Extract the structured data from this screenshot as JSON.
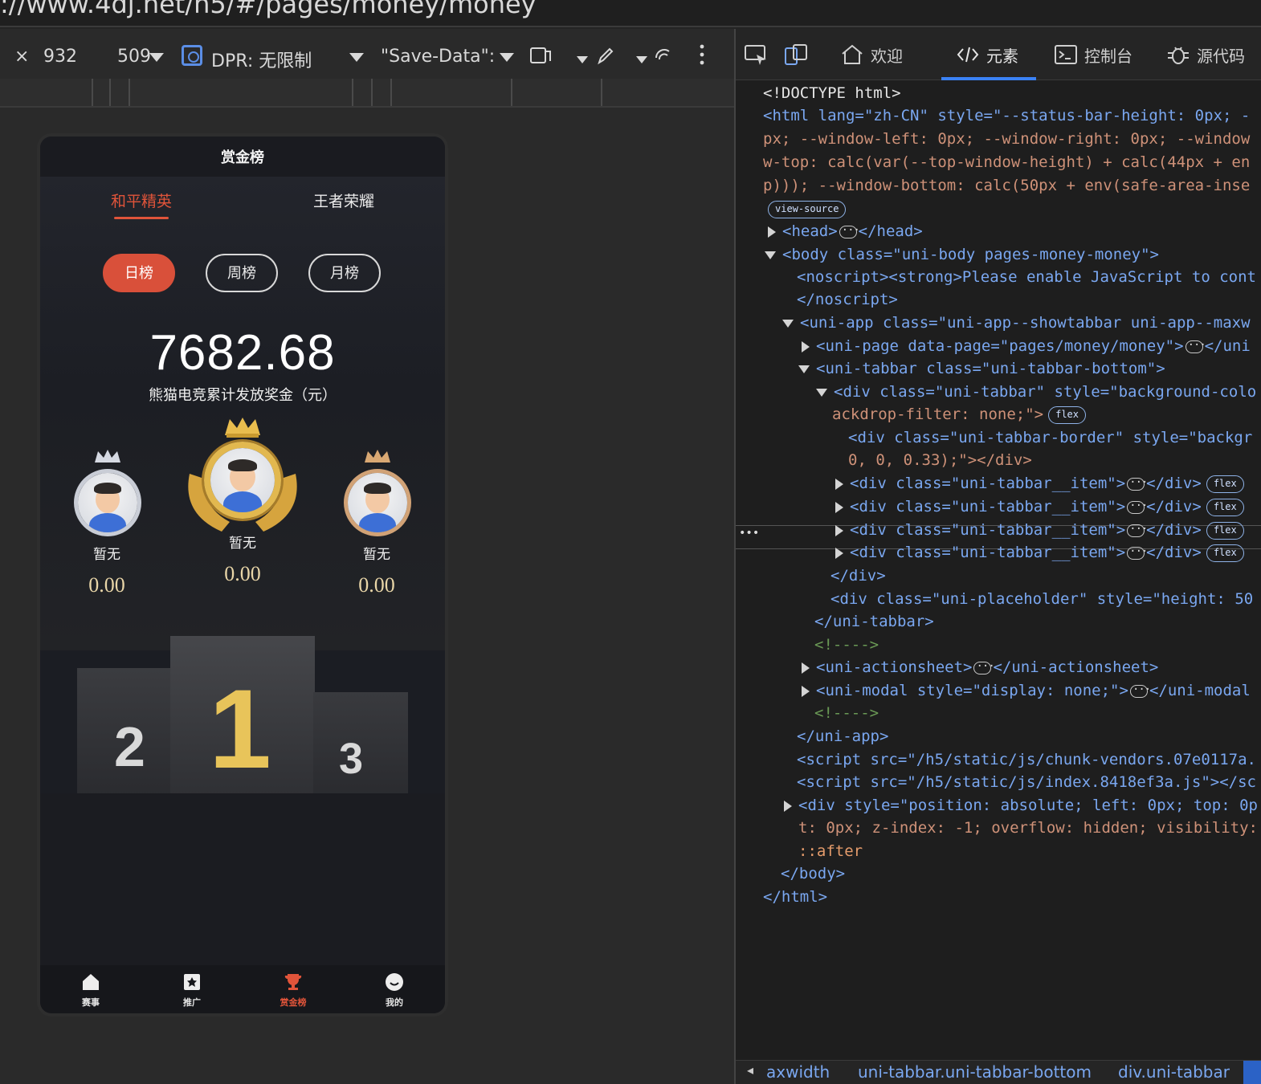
{
  "browser": {
    "url_fragment": "://www.4dj.net/h5/#/pages/money/money"
  },
  "emulator": {
    "close": "×",
    "width": "932",
    "height": "509",
    "dpr_label": "DPR: 无限制",
    "save_data_label": "\"Save-Data\":"
  },
  "phone": {
    "title": "赏金榜",
    "game_tabs": [
      {
        "label": "和平精英",
        "active": true
      },
      {
        "label": "王者荣耀",
        "active": false
      }
    ],
    "period_tabs": [
      {
        "label": "日榜",
        "active": true
      },
      {
        "label": "周榜",
        "active": false
      },
      {
        "label": "月榜",
        "active": false
      }
    ],
    "total_amount": "7682.68",
    "total_label": "熊猫电竞累计发放奖金（元）",
    "ranks": [
      {
        "rank": "1",
        "name": "暂无",
        "amount": "0.00"
      },
      {
        "rank": "2",
        "name": "暂无",
        "amount": "0.00"
      },
      {
        "rank": "3",
        "name": "暂无",
        "amount": "0.00"
      }
    ],
    "tabbar": [
      {
        "label": "赛事",
        "icon": "home-icon",
        "active": false
      },
      {
        "label": "推广",
        "icon": "promote-icon",
        "active": false
      },
      {
        "label": "赏金榜",
        "icon": "trophy-icon",
        "active": true
      },
      {
        "label": "我的",
        "icon": "profile-icon",
        "active": false
      }
    ],
    "colors": {
      "accent": "#e0543a",
      "gold": "#e2b84f"
    }
  },
  "devtools": {
    "tabs": [
      {
        "label": "欢迎",
        "icon": "home-icon"
      },
      {
        "label": "元素",
        "icon": "code-icon",
        "active": true
      },
      {
        "label": "控制台",
        "icon": "console-icon"
      },
      {
        "label": "源代码",
        "icon": "bug-icon"
      }
    ],
    "lines": {
      "l1": "<!DOCTYPE html>",
      "l2": "<html lang=\"zh-CN\" style=\"--status-bar-height: 0px; -",
      "l3": "px; --window-left: 0px; --window-right: 0px; --window",
      "l4": "w-top: calc(var(--top-window-height) + calc(44px + en",
      "l5": "p))); --window-bottom: calc(50px + env(safe-area-inse",
      "view_source": "view-source",
      "l6a": "<head>",
      "l6b": "</head>",
      "l7": "<body class=\"uni-body pages-money-money\">",
      "l8": "<noscript><strong>Please enable JavaScript to cont",
      "l9": "</noscript>",
      "l10": "<uni-app class=\"uni-app--showtabbar uni-app--maxw",
      "l11a": "<uni-page data-page=\"pages/money/money\">",
      "l11b": "</uni",
      "l12": "<uni-tabbar class=\"uni-tabbar-bottom\">",
      "l13": "<div class=\"uni-tabbar\" style=\"background-colo",
      "l14": "ackdrop-filter: none;\">",
      "flex": "flex",
      "l15": "<div class=\"uni-tabbar-border\" style=\"backgr",
      "l16": "0, 0, 0.33);\"></div>",
      "item": "<div class=\"uni-tabbar__item\">",
      "item_end": "</div>",
      "l21": "</div>",
      "l22": "<div class=\"uni-placeholder\" style=\"height: 50",
      "l23": "</uni-tabbar>",
      "comment": "<!---->",
      "l25a": "<uni-actionsheet>",
      "l25b": "</uni-actionsheet>",
      "l26a": "<uni-modal style=\"display: none;\">",
      "l26b": "</uni-modal",
      "l28": "</uni-app>",
      "l29": "<script src=\"/h5/static/js/chunk-vendors.07e0117a.",
      "l30": "<script src=\"/h5/static/js/index.8418ef3a.js\"></sc",
      "l31": "<div style=\"position: absolute; left: 0px; top: 0p",
      "l32": "t: 0px; z-index: -1; overflow: hidden; visibility:",
      "l33": "::after",
      "l34": "</body>",
      "l35": "</html>",
      "more_dots": "•••"
    },
    "breadcrumb": [
      "axwidth",
      "uni-tabbar.uni-tabbar-bottom",
      "div.uni-tabbar"
    ]
  }
}
